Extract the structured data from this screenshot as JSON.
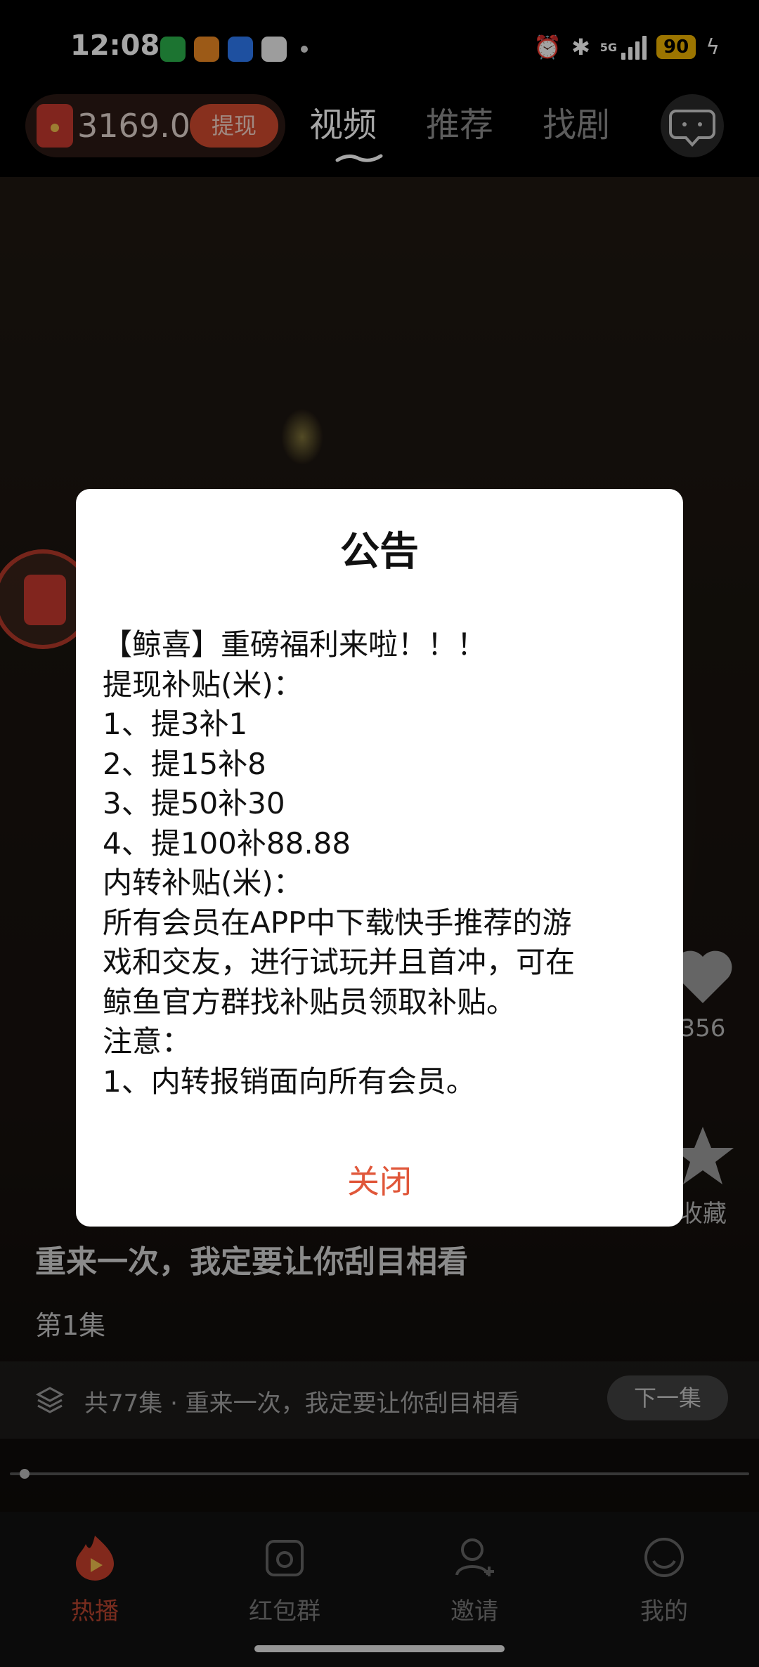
{
  "status_bar": {
    "time": "12:08",
    "network_label": "5G",
    "battery": "90",
    "app_icons": [
      "wechat-icon",
      "fox-app-icon",
      "message-app-icon",
      "qq-icon"
    ]
  },
  "top_bar": {
    "coin_amount": "3169.0",
    "withdraw_label": "提现",
    "tabs": [
      {
        "label": "视频",
        "active": true
      },
      {
        "label": "推荐",
        "active": false
      },
      {
        "label": "找剧",
        "active": false
      }
    ]
  },
  "video": {
    "like_count": "356",
    "collect_label": "收藏",
    "title": "重来一次，我定要让你刮目相看",
    "episode": "第1集",
    "series_info": "共77集 · 重来一次，我定要让你刮目相看",
    "next_label": "下一集",
    "progress_fraction": 0.01
  },
  "modal": {
    "title": "公告",
    "lines": [
      "【鲸喜】重磅福利来啦！！！",
      "提现补贴(米)：",
      "1、提3补1",
      "2、提15补8",
      "3、提50补30",
      "4、提100补88.88",
      "内转补贴(米)：",
      "所有会员在APP中下载快手推荐的游",
      "戏和交友，进行试玩并且首冲，可在",
      "鲸鱼官方群找补贴员领取补贴。",
      "注意：",
      "1、内转报销面向所有会员。"
    ],
    "close_label": "关闭"
  },
  "bottom_nav": [
    {
      "label": "热播",
      "icon": "flame-play-icon",
      "active": true
    },
    {
      "label": "红包群",
      "icon": "red-packet-group-icon",
      "active": false
    },
    {
      "label": "邀请",
      "icon": "invite-user-icon",
      "active": false
    },
    {
      "label": "我的",
      "icon": "profile-icon",
      "active": false
    }
  ],
  "colors": {
    "accent": "#e0573a",
    "active_nav": "#b9442f",
    "battery": "#f0b400"
  }
}
